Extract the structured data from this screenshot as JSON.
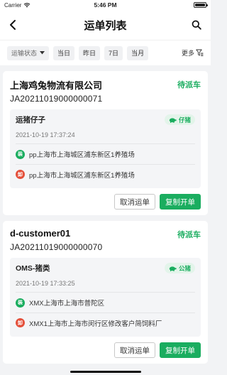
{
  "status_bar": {
    "carrier": "Carrier",
    "time": "5:46 PM"
  },
  "nav": {
    "title": "运单列表"
  },
  "filters": {
    "status_select": "运输状态",
    "chips": [
      "当日",
      "昨日",
      "7日",
      "当月"
    ],
    "more_label": "更多"
  },
  "waybills": [
    {
      "company": "上海鸡兔物流有限公司",
      "status": "待派车",
      "order_no": "JA20211019000000071",
      "cargo": "运猪仔子",
      "tag": "仔猪",
      "datetime": "2021-10-19 17:37:24",
      "load_badge": "装",
      "load_address": "pp上海市上海城区浦东新区1养殖场",
      "unload_badge": "卸",
      "unload_address": "pp上海市上海城区浦东新区1养殖场",
      "cancel_label": "取消运单",
      "copy_label": "复制开单"
    },
    {
      "company": "d-customer01",
      "status": "待派车",
      "order_no": "JA20211019000000070",
      "cargo": "OMS-猪类",
      "tag": "公猪",
      "datetime": "2021-10-19 17:33:25",
      "load_badge": "装",
      "load_address": "XMX上海市上海市普陀区",
      "unload_badge": "卸",
      "unload_address": "XMX1上海市上海市闵行区修改客户简饲料厂",
      "cancel_label": "取消运单",
      "copy_label": "复制开单"
    }
  ],
  "colors": {
    "accent": "#1aad5f",
    "unload": "#e4503b",
    "background": "#f2f3f5"
  }
}
